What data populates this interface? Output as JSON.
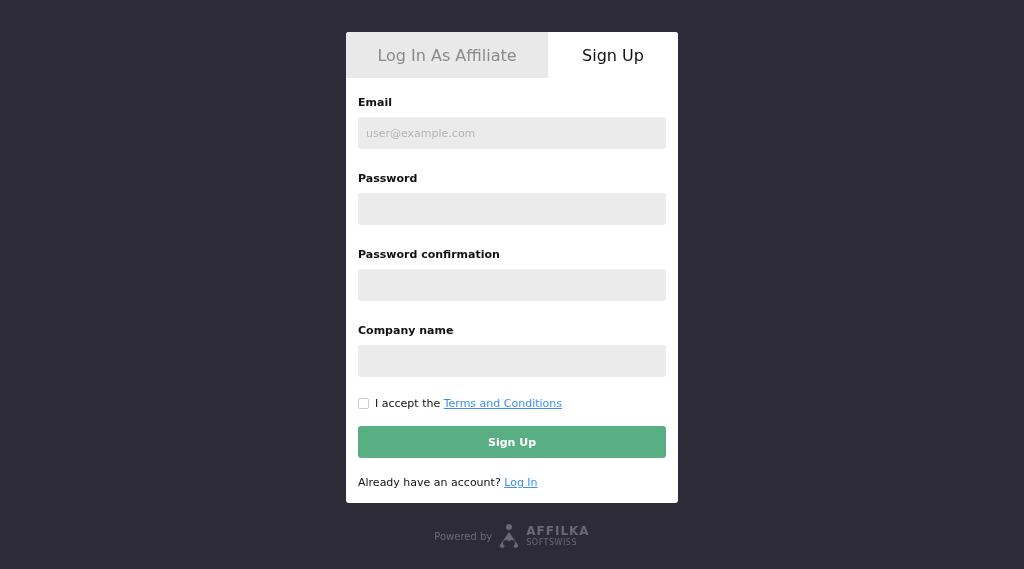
{
  "tabs": [
    {
      "label": "Log In As Affiliate",
      "selected": false
    },
    {
      "label": "Sign Up",
      "selected": true
    }
  ],
  "fields": [
    {
      "label": "Email",
      "placeholder": "user@example.com"
    },
    {
      "label": "Password"
    },
    {
      "label": "Password confirmation"
    },
    {
      "label": "Company name"
    }
  ],
  "terms": {
    "checked": false,
    "text": "I accept the",
    "link": "Terms and Conditions"
  },
  "submit_button": "Sign Up",
  "login_prompt": {
    "text": "Already have an account?",
    "link": "Log In"
  },
  "footer": {
    "powered_by": "Powered by",
    "brand": "AFFILKA",
    "sub_brand": "SOFTSWISS"
  }
}
